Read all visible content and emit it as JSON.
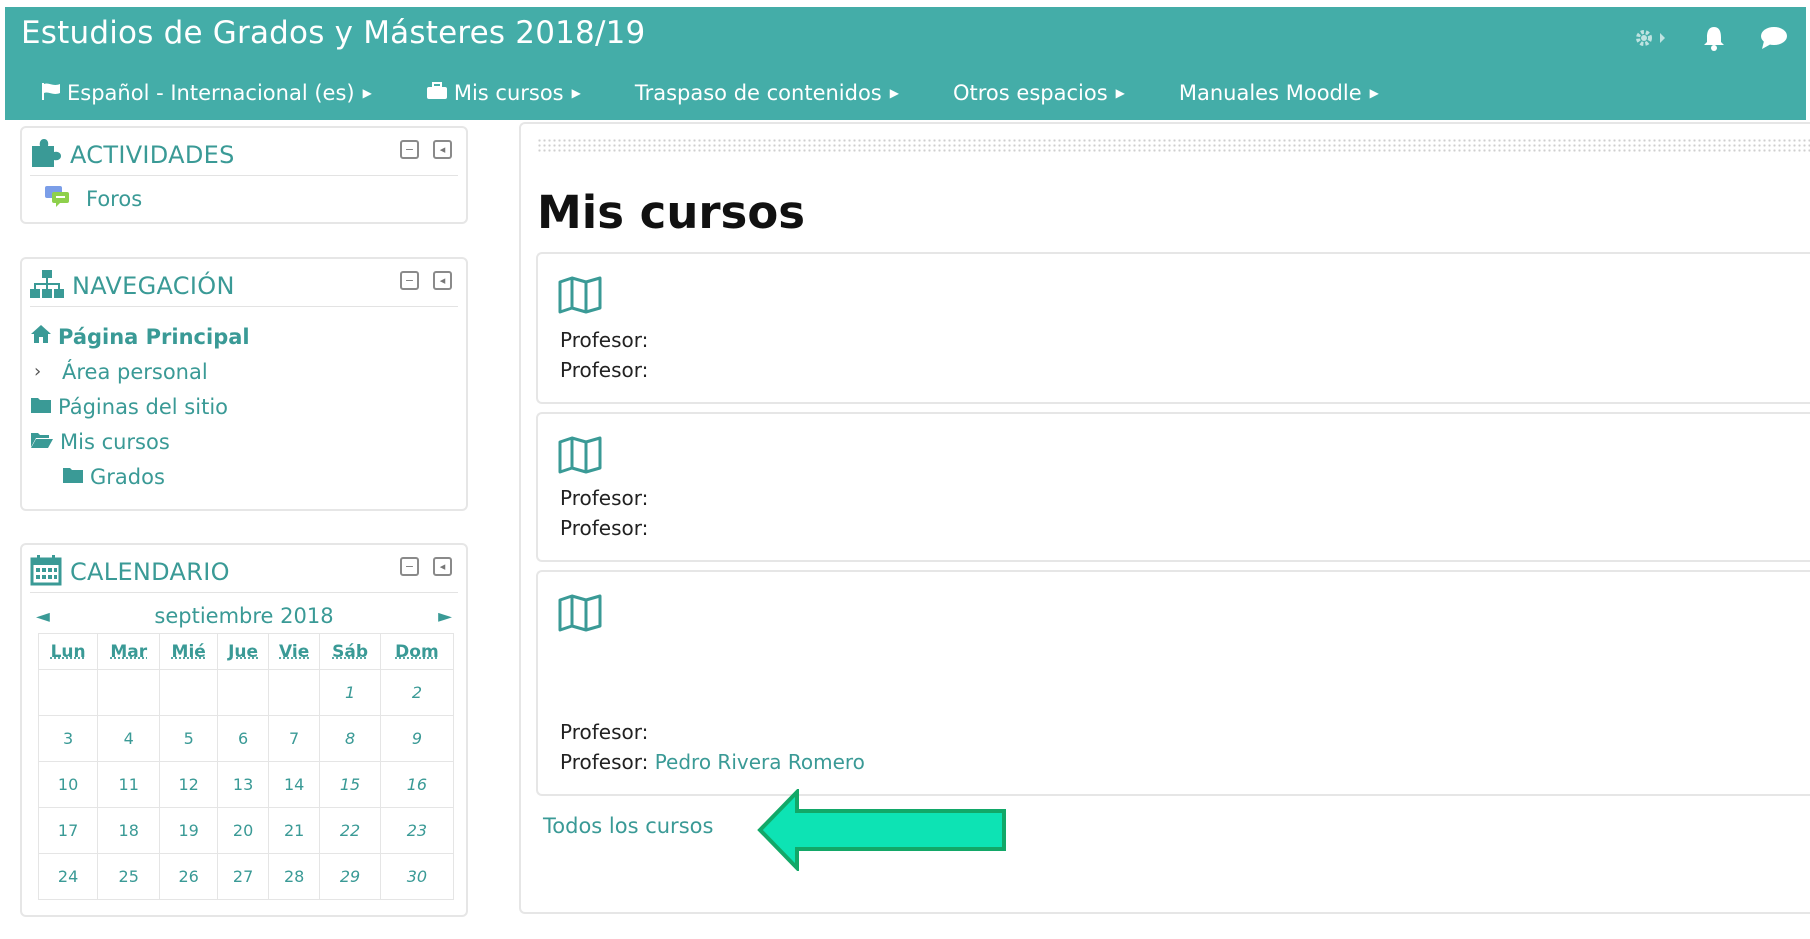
{
  "header": {
    "title": "Estudios de Grados y Másteres 2018/19",
    "icons": [
      "gear-icon",
      "bell-icon",
      "chat-icon"
    ]
  },
  "navbar": {
    "items": [
      {
        "label": "Español - Internacional (es)",
        "icon": "flag-icon"
      },
      {
        "label": "Mis cursos",
        "icon": "briefcase-icon"
      },
      {
        "label": "Traspaso de contenidos"
      },
      {
        "label": "Otros espacios"
      },
      {
        "label": "Manuales Moodle"
      }
    ]
  },
  "activities": {
    "title": "ACTIVIDADES",
    "items": [
      {
        "label": "Foros",
        "icon": "forum-icon"
      }
    ]
  },
  "navigation": {
    "title": "NAVEGACIÓN",
    "items": [
      {
        "label": "Página Principal",
        "icon": "home-icon"
      },
      {
        "label": "Área personal",
        "icon": "chevron-right-icon"
      },
      {
        "label": "Páginas del sitio",
        "icon": "folder-icon"
      },
      {
        "label": "Mis cursos",
        "icon": "folder-open-icon"
      },
      {
        "label": "Grados",
        "icon": "folder-icon"
      }
    ]
  },
  "calendar": {
    "title": "CALENDARIO",
    "month": "septiembre 2018",
    "prev": "◄",
    "next": "►",
    "weekdays": [
      "Lun",
      "Mar",
      "Mié",
      "Jue",
      "Vie",
      "Sáb",
      "Dom"
    ],
    "weeks": [
      [
        "",
        "",
        "",
        "",
        "",
        "1",
        "2"
      ],
      [
        "3",
        "4",
        "5",
        "6",
        "7",
        "8",
        "9"
      ],
      [
        "10",
        "11",
        "12",
        "13",
        "14",
        "15",
        "16"
      ],
      [
        "17",
        "18",
        "19",
        "20",
        "21",
        "22",
        "23"
      ],
      [
        "24",
        "25",
        "26",
        "27",
        "28",
        "29",
        "30"
      ]
    ]
  },
  "main": {
    "title": "Mis cursos",
    "courses": [
      {
        "teachers": [
          {
            "label": "Profesor:",
            "name": ""
          },
          {
            "label": "Profesor:",
            "name": ""
          }
        ]
      },
      {
        "teachers": [
          {
            "label": "Profesor:",
            "name": ""
          },
          {
            "label": "Profesor:",
            "name": ""
          }
        ]
      },
      {
        "teachers": [
          {
            "label": "Profesor:",
            "name": ""
          },
          {
            "label": "Profesor:",
            "name": "Pedro Rivera Romero"
          }
        ]
      }
    ],
    "all_courses_link": "Todos los cursos"
  },
  "colors": {
    "brand": "#44ada8",
    "link": "#3a9a96",
    "annotation_arrow": "#0de3b4"
  }
}
